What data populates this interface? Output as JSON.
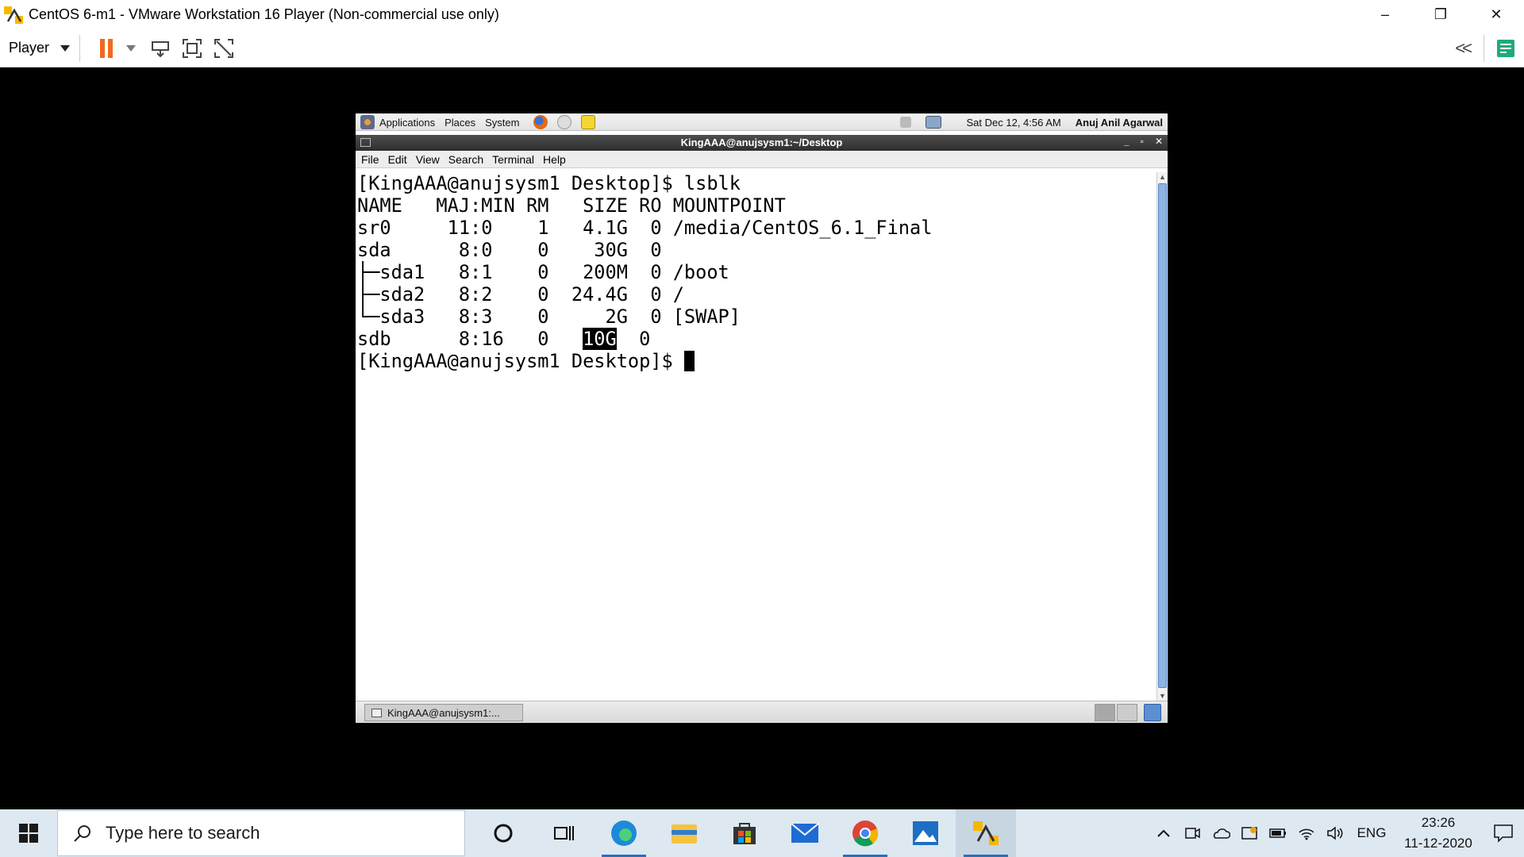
{
  "window": {
    "title": "CentOS 6-m1 - VMware Workstation 16 Player (Non-commercial use only)",
    "controls": {
      "minimize": "–",
      "restore": "❐",
      "close": "✕"
    }
  },
  "toolbar": {
    "player_label": "Player",
    "collapse_label": "<<"
  },
  "guest_panel": {
    "menus": [
      "Applications",
      "Places",
      "System"
    ],
    "datetime": "Sat Dec 12,  4:56 AM",
    "user": "Anuj Anil Agarwal"
  },
  "terminal": {
    "title": "KingAAA@anujsysm1:~/Desktop",
    "controls": {
      "minimize": "_",
      "maximize": "▫",
      "close": "✕"
    },
    "menu": [
      "File",
      "Edit",
      "View",
      "Search",
      "Terminal",
      "Help"
    ],
    "lines": [
      "[KingAAA@anujsysm1 Desktop]$ lsblk",
      "NAME   MAJ:MIN RM   SIZE RO MOUNTPOINT",
      "sr0     11:0    1   4.1G  0 /media/CentOS_6.1_Final",
      "sda      8:0    0    30G  0 ",
      "├─sda1   8:1    0   200M  0 /boot",
      "├─sda2   8:2    0  24.4G  0 /",
      "└─sda3   8:3    0     2G  0 [SWAP]"
    ],
    "sdb_prefix": "sdb      8:16   0   ",
    "sdb_size": "10G",
    "sdb_suffix": "  0",
    "prompt": "[KingAAA@anujsysm1 Desktop]$ "
  },
  "guest_taskbar": {
    "task_label": "KingAAA@anujsysm1:..."
  },
  "win_taskbar": {
    "search_placeholder": "Type here to search",
    "lang": "ENG",
    "time": "23:26",
    "date": "11-12-2020"
  },
  "colors": {
    "pause": "#f06a1d",
    "vm_accent": "#f5b800",
    "scroll_thumb": "#8db4e2",
    "taskbar_bg": "#dde8f1"
  }
}
